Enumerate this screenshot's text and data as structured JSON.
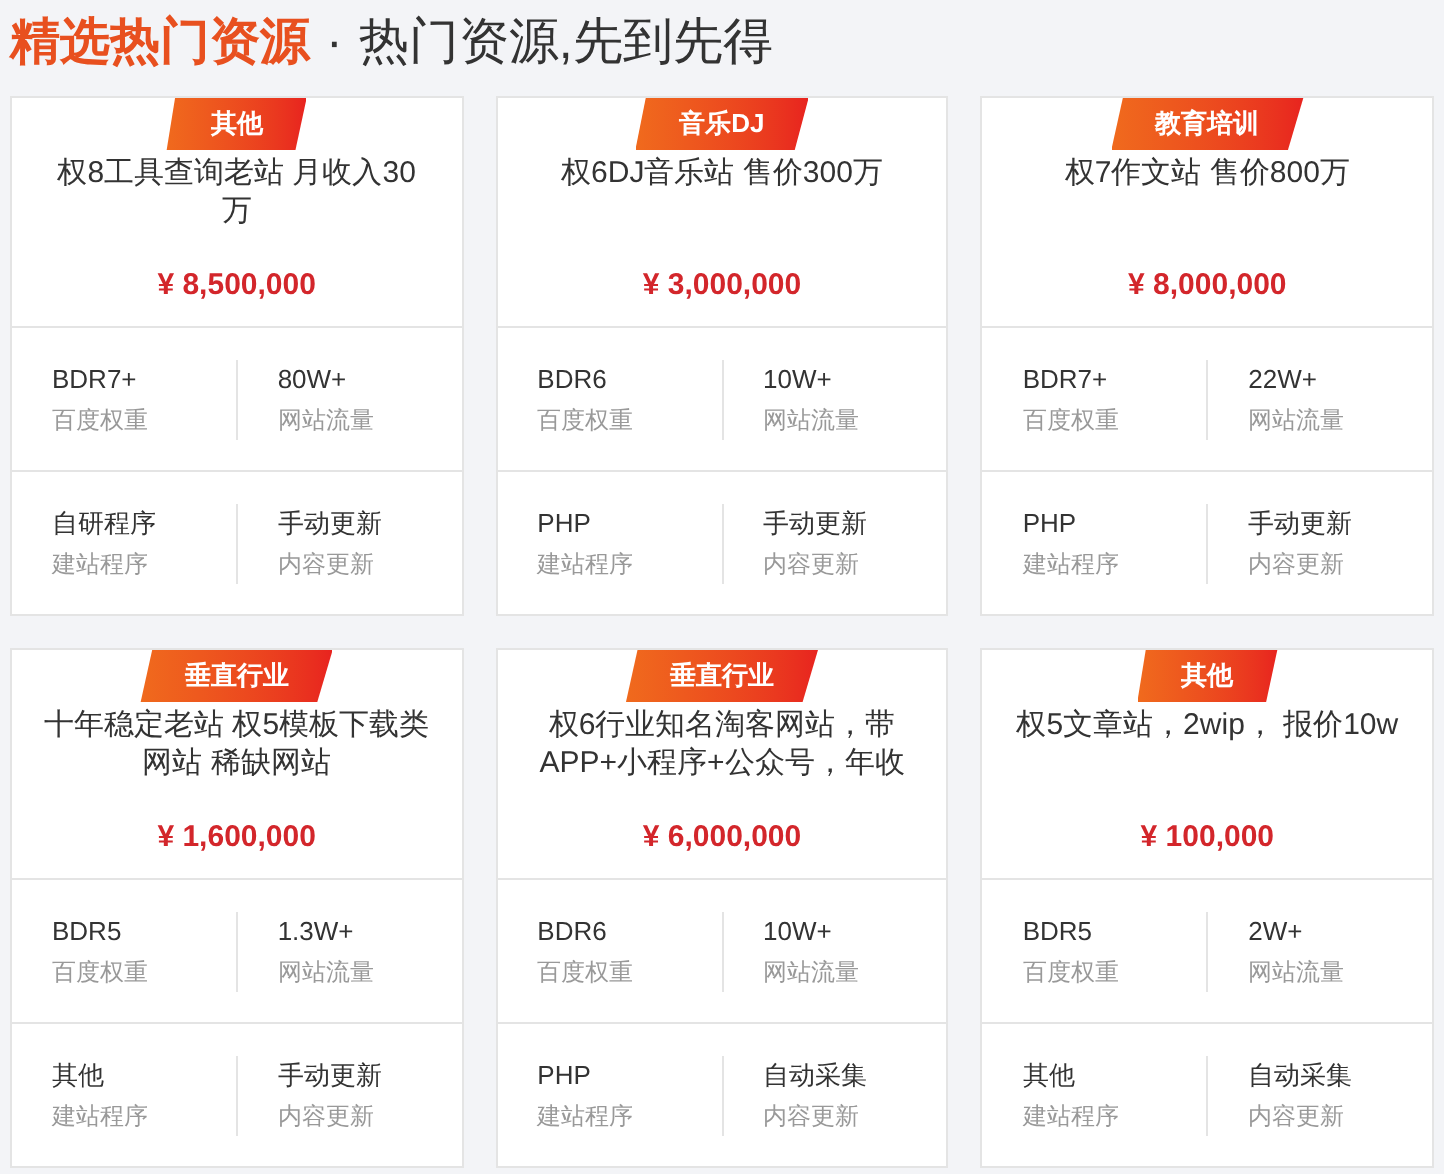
{
  "header": {
    "title": "精选热门资源",
    "separator": "·",
    "subtitle": "热门资源,先到先得"
  },
  "cards": [
    {
      "tag": "其他",
      "title": "权8工具查询老站 月收入30万",
      "price": "¥ 8,500,000",
      "stats": [
        {
          "value": "BDR7+",
          "label": "百度权重"
        },
        {
          "value": "80W+",
          "label": "网站流量"
        },
        {
          "value": "自研程序",
          "label": "建站程序"
        },
        {
          "value": "手动更新",
          "label": "内容更新"
        }
      ]
    },
    {
      "tag": "音乐DJ",
      "title": "权6DJ音乐站 售价300万",
      "price": "¥ 3,000,000",
      "stats": [
        {
          "value": "BDR6",
          "label": "百度权重"
        },
        {
          "value": "10W+",
          "label": "网站流量"
        },
        {
          "value": "PHP",
          "label": "建站程序"
        },
        {
          "value": "手动更新",
          "label": "内容更新"
        }
      ]
    },
    {
      "tag": "教育培训",
      "title": "权7作文站 售价800万",
      "price": "¥ 8,000,000",
      "stats": [
        {
          "value": "BDR7+",
          "label": "百度权重"
        },
        {
          "value": "22W+",
          "label": "网站流量"
        },
        {
          "value": "PHP",
          "label": "建站程序"
        },
        {
          "value": "手动更新",
          "label": "内容更新"
        }
      ]
    },
    {
      "tag": "垂直行业",
      "title": "十年稳定老站 权5模板下载类网站 稀缺网站",
      "price": "¥ 1,600,000",
      "stats": [
        {
          "value": "BDR5",
          "label": "百度权重"
        },
        {
          "value": "1.3W+",
          "label": "网站流量"
        },
        {
          "value": "其他",
          "label": "建站程序"
        },
        {
          "value": "手动更新",
          "label": "内容更新"
        }
      ]
    },
    {
      "tag": "垂直行业",
      "title": "权6行业知名淘客网站，带APP+小程序+公众号，年收",
      "price": "¥ 6,000,000",
      "stats": [
        {
          "value": "BDR6",
          "label": "百度权重"
        },
        {
          "value": "10W+",
          "label": "网站流量"
        },
        {
          "value": "PHP",
          "label": "建站程序"
        },
        {
          "value": "自动采集",
          "label": "内容更新"
        }
      ]
    },
    {
      "tag": "其他",
      "title": "权5文章站，2wip， 报价10w",
      "price": "¥ 100,000",
      "stats": [
        {
          "value": "BDR5",
          "label": "百度权重"
        },
        {
          "value": "2W+",
          "label": "网站流量"
        },
        {
          "value": "其他",
          "label": "建站程序"
        },
        {
          "value": "自动采集",
          "label": "内容更新"
        }
      ]
    }
  ]
}
